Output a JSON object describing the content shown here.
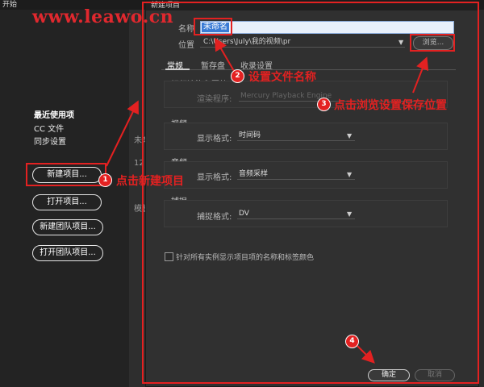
{
  "start_window": {
    "title": "开始",
    "nav": [
      "最近使用项",
      "CC 文件",
      "同步设置"
    ],
    "buttons": [
      "新建项目...",
      "打开项目...",
      "新建团队项目...",
      "打开团队项目..."
    ],
    "behind_text": [
      "未命",
      "12",
      "模板"
    ]
  },
  "watermark": "www.leawo.cn",
  "dialog": {
    "title": "新建项目",
    "name_label": "名称",
    "name_value": "未命名",
    "location_label": "位置",
    "location_value": "C:\\Users\\July\\我的视频\\pr",
    "browse_label": "浏览...",
    "tabs": [
      "常规",
      "暂存盘",
      "收录设置"
    ],
    "groups": {
      "render": {
        "title": "视频渲染和回放",
        "renderer_label": "渲染程序:",
        "renderer_value": "Mercury Playback Engine"
      },
      "video": {
        "title": "视频",
        "format_label": "显示格式:",
        "format_value": "时间码"
      },
      "audio": {
        "title": "音频",
        "format_label": "显示格式:",
        "format_value": "音频采样"
      },
      "capture": {
        "title": "捕捉",
        "format_label": "捕捉格式:",
        "format_value": "DV"
      }
    },
    "checkbox_label": "针对所有实例显示项目项的名称和标签颜色",
    "ok_label": "确定",
    "cancel_label": "取消"
  },
  "annotations": {
    "colors": {
      "accent": "#e32121"
    },
    "steps": [
      {
        "num": "1",
        "text": "点击新建项目"
      },
      {
        "num": "2",
        "text": "设置文件名称"
      },
      {
        "num": "3",
        "text": "点击浏览设置保存位置"
      },
      {
        "num": "4",
        "text": ""
      }
    ]
  }
}
